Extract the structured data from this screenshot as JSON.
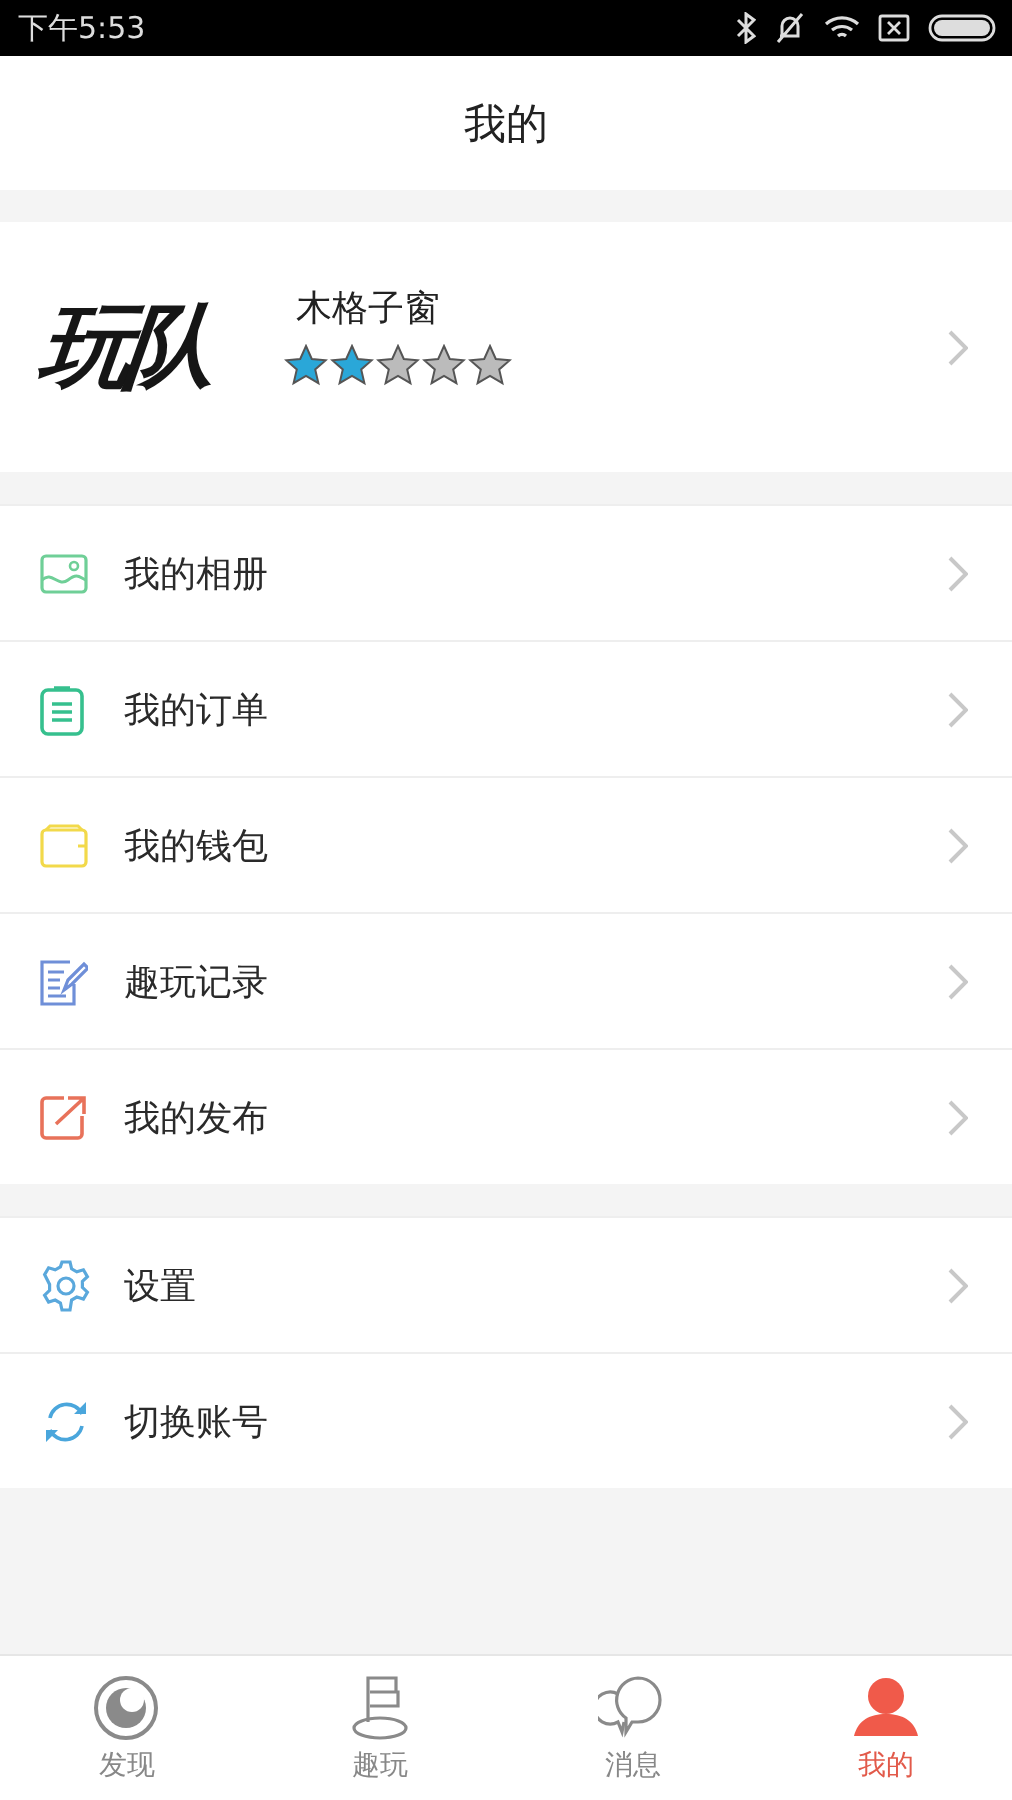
{
  "status_bar": {
    "time": "下午5:53"
  },
  "header": {
    "title": "我的"
  },
  "profile": {
    "logo": "玩队",
    "name": "木格子窗",
    "stars": 2
  },
  "menu_groups": [
    {
      "items": [
        {
          "label": "我的相册"
        },
        {
          "label": "我的订单"
        },
        {
          "label": "我的钱包"
        },
        {
          "label": "趣玩记录"
        },
        {
          "label": "我的发布"
        }
      ]
    },
    {
      "items": [
        {
          "label": "设置"
        },
        {
          "label": "切换账号"
        }
      ]
    }
  ],
  "tab_bar": [
    {
      "label": "发现",
      "selected": false
    },
    {
      "label": "趣玩",
      "selected": false
    },
    {
      "label": "消息",
      "selected": false
    },
    {
      "label": "我的",
      "selected": true
    }
  ]
}
